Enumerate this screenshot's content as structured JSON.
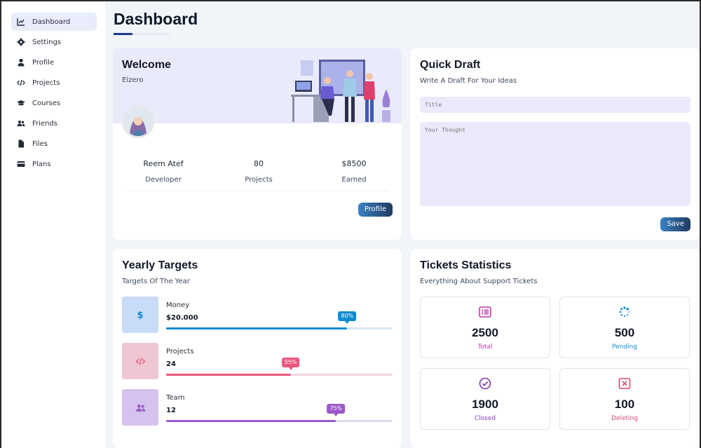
{
  "sidebar": {
    "items": [
      {
        "label": "Dashboard",
        "icon": "chart-line-icon",
        "active": true
      },
      {
        "label": "Settings",
        "icon": "gear-icon"
      },
      {
        "label": "Profile",
        "icon": "user-icon"
      },
      {
        "label": "Projects",
        "icon": "code-icon"
      },
      {
        "label": "Courses",
        "icon": "graduation-cap-icon"
      },
      {
        "label": "Friends",
        "icon": "users-icon"
      },
      {
        "label": "Files",
        "icon": "file-icon"
      },
      {
        "label": "Plans",
        "icon": "credit-card-icon"
      }
    ]
  },
  "page": {
    "title": "Dashboard"
  },
  "welcome": {
    "title": "Welcome",
    "name": "Elzero",
    "stats": [
      {
        "value": "Reem Atef",
        "label": "Developer"
      },
      {
        "value": "80",
        "label": "Projects"
      },
      {
        "value": "$8500",
        "label": "Earned"
      }
    ],
    "button": "Profile"
  },
  "draft": {
    "title": "Quick Draft",
    "subtitle": "Write A Draft For Your Ideas",
    "title_placeholder": "Title",
    "body_placeholder": "Your Thought",
    "button": "Save"
  },
  "targets": {
    "title": "Yearly Targets",
    "subtitle": "Targets Of The Year",
    "items": [
      {
        "label": "Money",
        "value": "$20.000",
        "percent": 80,
        "percent_label": "80%",
        "color": "#0c8bd1",
        "track": "#d4e6f5",
        "bg": "#c9dcf7",
        "icon": "dollar-icon"
      },
      {
        "label": "Projects",
        "value": "24",
        "percent": 55,
        "percent_label": "55%",
        "color": "#e8577f",
        "track": "#f2d6df",
        "bg": "#efc7d3",
        "icon": "code-icon"
      },
      {
        "label": "Team",
        "value": "12",
        "percent": 75,
        "percent_label": "75%",
        "color": "#9b59c9",
        "track": "#e1d6ef",
        "bg": "#d6c2ee",
        "icon": "users-icon"
      }
    ]
  },
  "tickets": {
    "title": "Tickets Statistics",
    "subtitle": "Everything About Support Tickets",
    "items": [
      {
        "value": "2500",
        "label": "Total",
        "color": "#c237b1",
        "icon": "list-icon"
      },
      {
        "value": "500",
        "label": "Pending",
        "color": "#0c8bd1",
        "icon": "spinner-icon"
      },
      {
        "value": "1900",
        "label": "Closed",
        "color": "#7d3cb5",
        "icon": "check-circle-icon"
      },
      {
        "value": "100",
        "label": "Deleting",
        "color": "#d64a6e",
        "icon": "x-square-icon"
      }
    ]
  }
}
